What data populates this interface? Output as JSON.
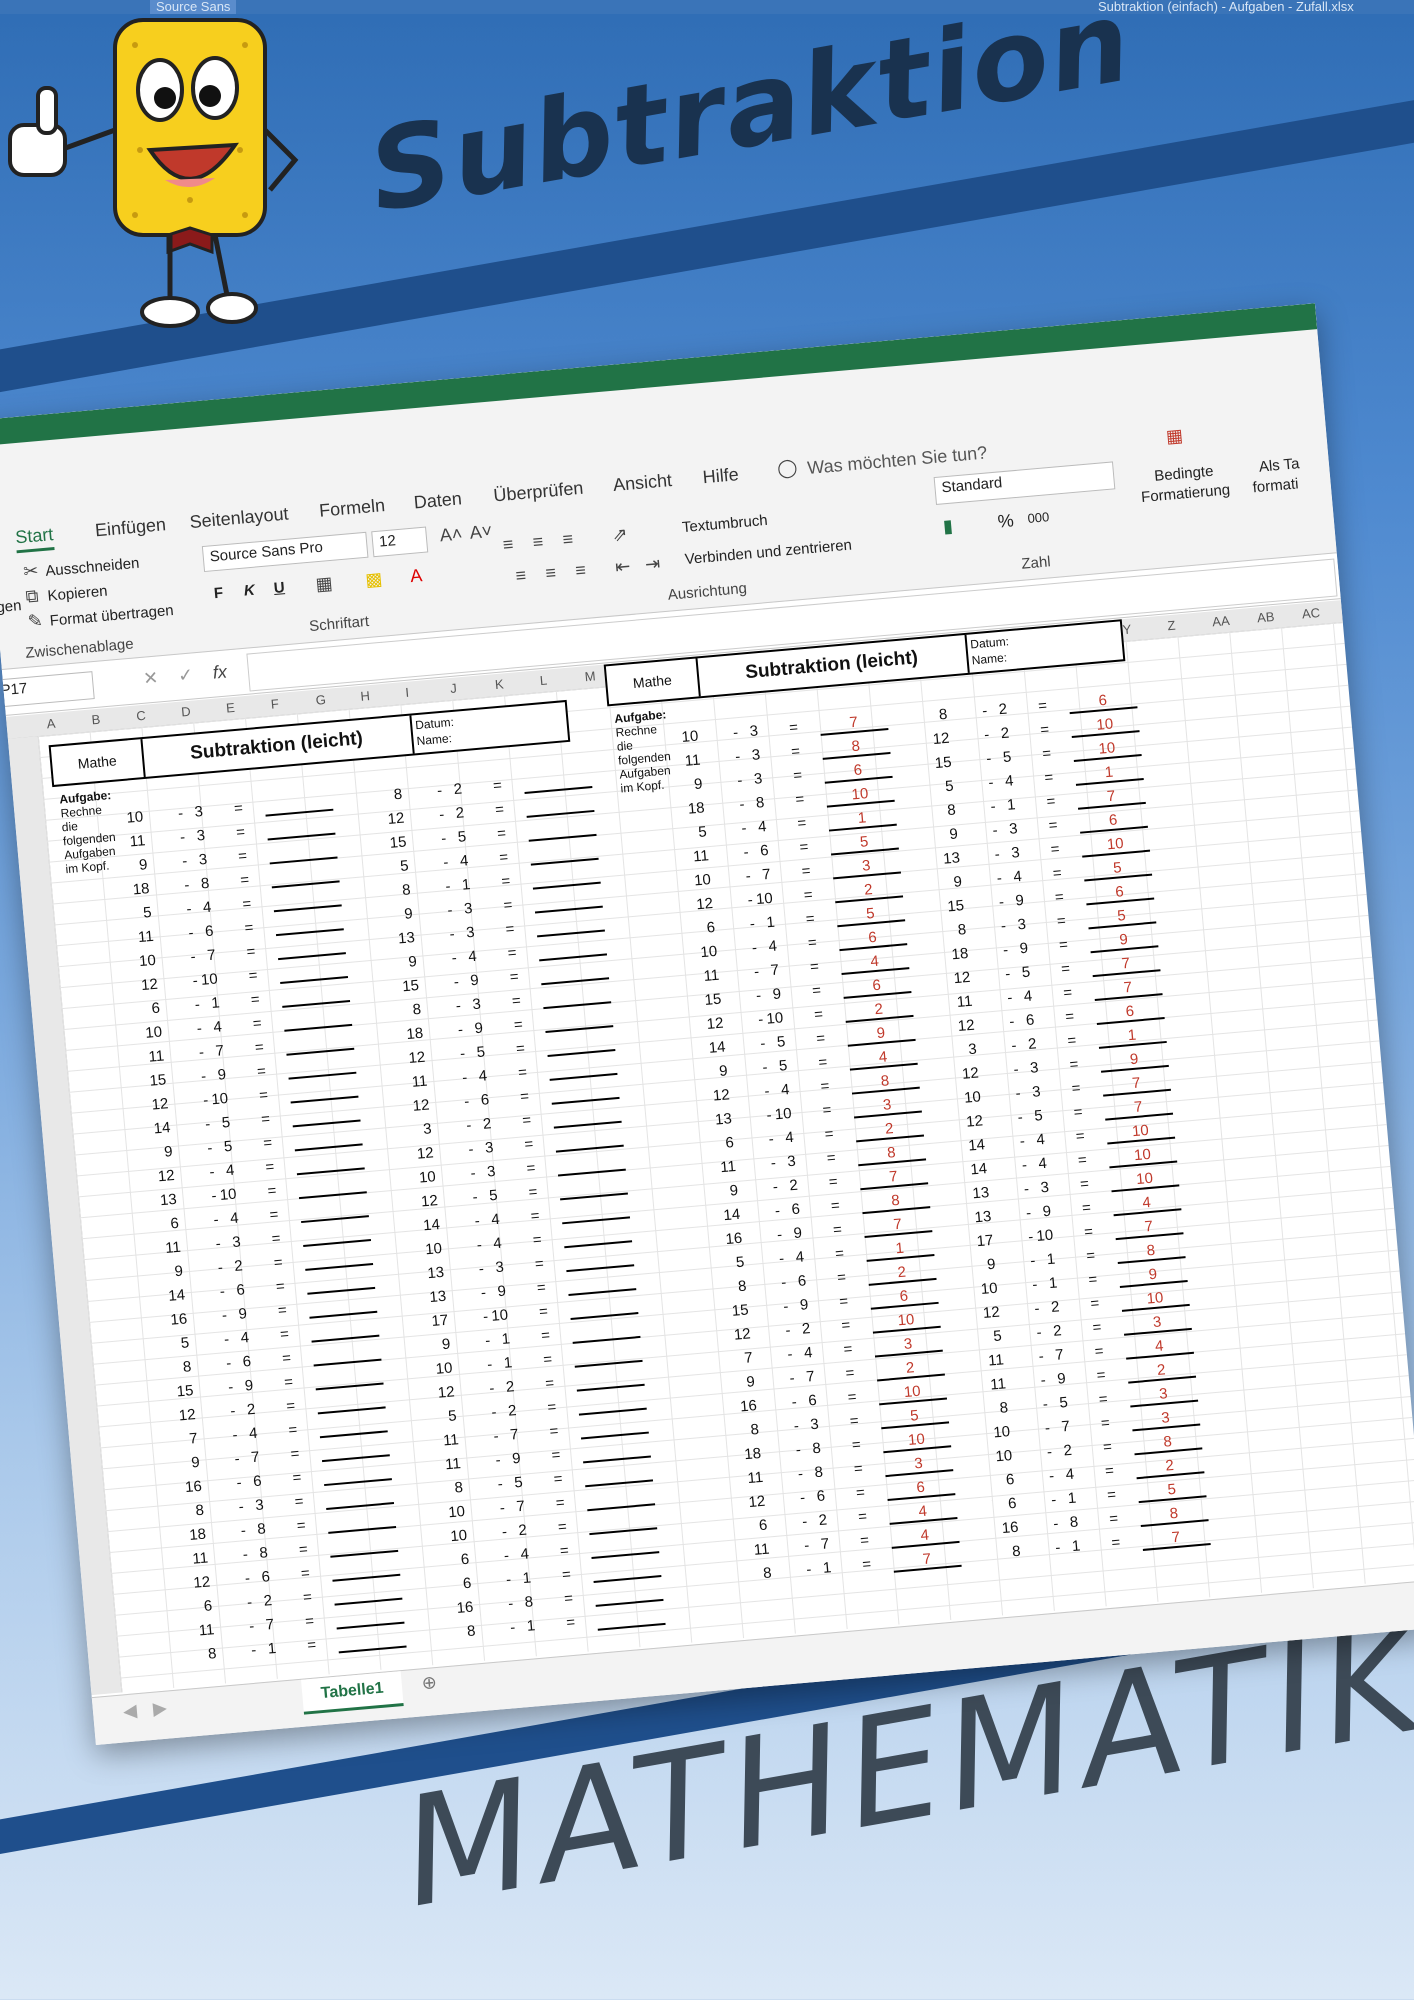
{
  "window_title": "Subtraktion (einfach) - Aufgaben - Zufall.xlsx",
  "font_box": "Source Sans",
  "poster": {
    "title": "Subtraktion",
    "subject": "MATHEMATIK"
  },
  "ribbon": {
    "tabs": [
      "Start",
      "Einfügen",
      "Seitenlayout",
      "Formeln",
      "Daten",
      "Überprüfen",
      "Ansicht",
      "Hilfe"
    ],
    "tell_me": "Was möchten Sie tun?",
    "clipboard": {
      "cut": "Ausschneiden",
      "copy": "Kopieren",
      "format_painter": "Format übertragen",
      "group": "Zwischenablage",
      "paste_partial": "gen"
    },
    "font": {
      "name": "Source Sans Pro",
      "size": "12",
      "bold": "F",
      "italic": "K",
      "underline": "U",
      "group": "Schriftart"
    },
    "alignment": {
      "wrap": "Textumbruch",
      "merge": "Verbinden und zentrieren",
      "group": "Ausrichtung"
    },
    "number": {
      "format": "Standard",
      "percent": "%",
      "thousands": "000",
      "group": "Zahl"
    },
    "styles": {
      "conditional_1": "Bedingte",
      "conditional_2": "Formatierung",
      "table_1": "Als Ta",
      "table_2": "formati"
    }
  },
  "name_box": "P17",
  "columns": [
    "A",
    "B",
    "C",
    "D",
    "E",
    "F",
    "G",
    "H",
    "I",
    "J",
    "K",
    "L",
    "M",
    "N",
    "O",
    "P",
    "Q",
    "R",
    "S",
    "T",
    "U",
    "V",
    "W",
    "X",
    "Y",
    "Z",
    "AA",
    "AB",
    "AC"
  ],
  "sheet_tab": "Tabelle1",
  "worksheet": {
    "mathe": "Mathe",
    "title": "Subtraktion (leicht)",
    "datum": "Datum:",
    "name": "Name:",
    "aufgabe_bold": "Aufgabe:",
    "aufgabe_text": "Rechne die folgenden Aufgaben im Kopf.",
    "minus": "-",
    "equals": "=",
    "left_columns": [
      [
        [
          10,
          3
        ],
        [
          11,
          3
        ],
        [
          9,
          3
        ],
        [
          18,
          8
        ],
        [
          5,
          4
        ],
        [
          11,
          6
        ],
        [
          10,
          7
        ],
        [
          12,
          10
        ],
        [
          6,
          1
        ],
        [
          10,
          4
        ],
        [
          11,
          7
        ],
        [
          15,
          9
        ],
        [
          12,
          10
        ],
        [
          14,
          5
        ],
        [
          9,
          5
        ],
        [
          12,
          4
        ],
        [
          13,
          10
        ],
        [
          6,
          4
        ],
        [
          11,
          3
        ],
        [
          9,
          2
        ],
        [
          14,
          6
        ],
        [
          16,
          9
        ],
        [
          5,
          4
        ],
        [
          8,
          6
        ],
        [
          15,
          9
        ],
        [
          12,
          2
        ],
        [
          7,
          4
        ],
        [
          9,
          7
        ],
        [
          16,
          6
        ],
        [
          8,
          3
        ],
        [
          18,
          8
        ],
        [
          11,
          8
        ],
        [
          12,
          6
        ],
        [
          6,
          2
        ],
        [
          11,
          7
        ],
        [
          8,
          1
        ]
      ],
      [
        [
          8,
          2
        ],
        [
          12,
          2
        ],
        [
          15,
          5
        ],
        [
          5,
          4
        ],
        [
          8,
          1
        ],
        [
          9,
          3
        ],
        [
          13,
          3
        ],
        [
          9,
          4
        ],
        [
          15,
          9
        ],
        [
          8,
          3
        ],
        [
          18,
          9
        ],
        [
          12,
          5
        ],
        [
          11,
          4
        ],
        [
          12,
          6
        ],
        [
          3,
          2
        ],
        [
          12,
          3
        ],
        [
          10,
          3
        ],
        [
          12,
          5
        ],
        [
          14,
          4
        ],
        [
          10,
          4
        ],
        [
          13,
          3
        ],
        [
          13,
          9
        ],
        [
          17,
          10
        ],
        [
          9,
          1
        ],
        [
          10,
          1
        ],
        [
          12,
          2
        ],
        [
          5,
          2
        ],
        [
          11,
          7
        ],
        [
          11,
          9
        ],
        [
          8,
          5
        ],
        [
          10,
          7
        ],
        [
          10,
          2
        ],
        [
          6,
          4
        ],
        [
          6,
          1
        ],
        [
          16,
          8
        ],
        [
          8,
          1
        ]
      ]
    ],
    "right_columns": [
      [
        [
          10,
          3,
          7
        ],
        [
          11,
          3,
          8
        ],
        [
          9,
          3,
          6
        ],
        [
          18,
          8,
          10
        ],
        [
          5,
          4,
          1
        ],
        [
          11,
          6,
          5
        ],
        [
          10,
          7,
          3
        ],
        [
          12,
          10,
          2
        ],
        [
          6,
          1,
          5
        ],
        [
          10,
          4,
          6
        ],
        [
          11,
          7,
          4
        ],
        [
          15,
          9,
          6
        ],
        [
          12,
          10,
          2
        ],
        [
          14,
          5,
          9
        ],
        [
          9,
          5,
          4
        ],
        [
          12,
          4,
          8
        ],
        [
          13,
          10,
          3
        ],
        [
          6,
          4,
          2
        ],
        [
          11,
          3,
          8
        ],
        [
          9,
          2,
          7
        ],
        [
          14,
          6,
          8
        ],
        [
          16,
          9,
          7
        ],
        [
          5,
          4,
          1
        ],
        [
          8,
          6,
          2
        ],
        [
          15,
          9,
          6
        ],
        [
          12,
          2,
          10
        ],
        [
          7,
          4,
          3
        ],
        [
          9,
          7,
          2
        ],
        [
          16,
          6,
          10
        ],
        [
          8,
          3,
          5
        ],
        [
          18,
          8,
          10
        ],
        [
          11,
          8,
          3
        ],
        [
          12,
          6,
          6
        ],
        [
          6,
          2,
          4
        ],
        [
          11,
          7,
          4
        ],
        [
          8,
          1,
          7
        ]
      ],
      [
        [
          8,
          2,
          6
        ],
        [
          12,
          2,
          10
        ],
        [
          15,
          5,
          10
        ],
        [
          5,
          4,
          1
        ],
        [
          8,
          1,
          7
        ],
        [
          9,
          3,
          6
        ],
        [
          13,
          3,
          10
        ],
        [
          9,
          4,
          5
        ],
        [
          15,
          9,
          6
        ],
        [
          8,
          3,
          5
        ],
        [
          18,
          9,
          9
        ],
        [
          12,
          5,
          7
        ],
        [
          11,
          4,
          7
        ],
        [
          12,
          6,
          6
        ],
        [
          3,
          2,
          1
        ],
        [
          12,
          3,
          9
        ],
        [
          10,
          3,
          7
        ],
        [
          12,
          5,
          7
        ],
        [
          14,
          4,
          10
        ],
        [
          14,
          4,
          10
        ],
        [
          13,
          3,
          10
        ],
        [
          13,
          9,
          4
        ],
        [
          17,
          10,
          7
        ],
        [
          9,
          1,
          8
        ],
        [
          10,
          1,
          9
        ],
        [
          12,
          2,
          10
        ],
        [
          5,
          2,
          3
        ],
        [
          11,
          7,
          4
        ],
        [
          11,
          9,
          2
        ],
        [
          8,
          5,
          3
        ],
        [
          10,
          7,
          3
        ],
        [
          10,
          2,
          8
        ],
        [
          6,
          4,
          2
        ],
        [
          6,
          1,
          5
        ],
        [
          16,
          8,
          8
        ],
        [
          8,
          1,
          7
        ]
      ]
    ]
  },
  "colors": {
    "excel_green": "#217346",
    "answer_red": "#c0392b",
    "poster_title": "#19324f",
    "band": "#1f4f8c"
  }
}
